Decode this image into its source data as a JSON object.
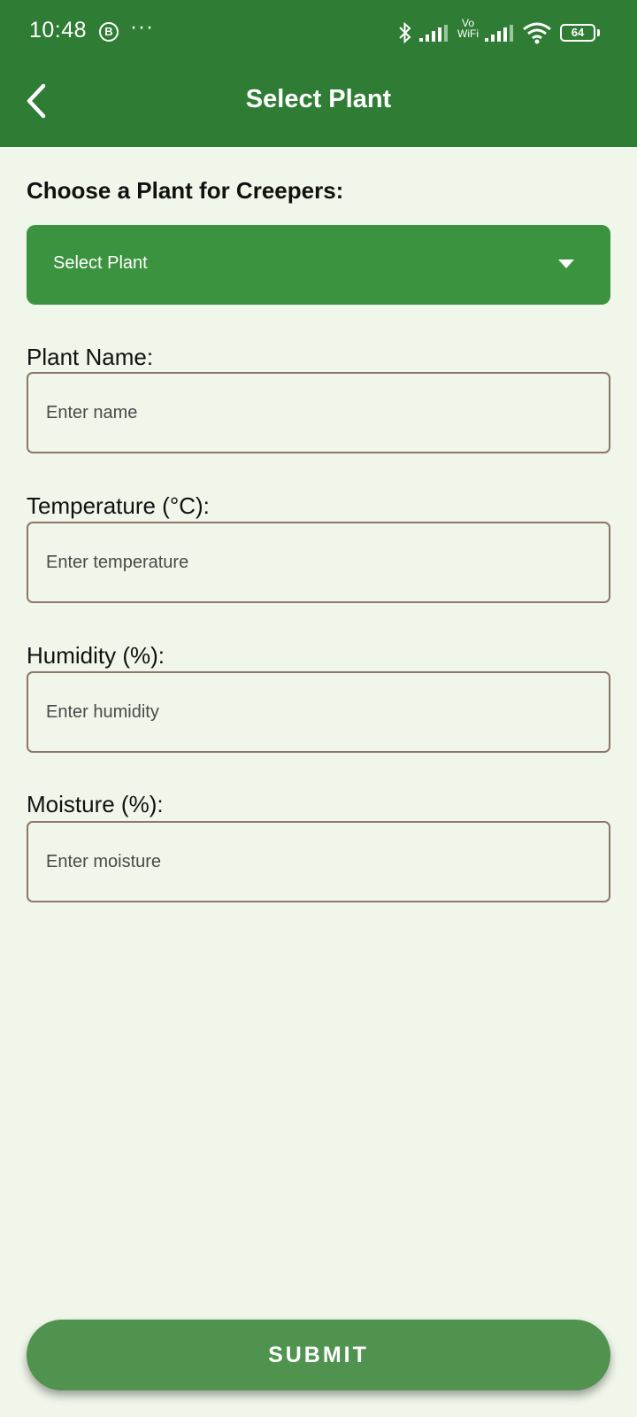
{
  "status_bar": {
    "time": "10:48",
    "notification_badge": "B",
    "more_indicator": "···",
    "vowifi_top": "Vo",
    "vowifi_bottom": "WiFi",
    "battery_level": "64",
    "icons": [
      "bluetooth-icon",
      "signal-icon",
      "vowifi-icon",
      "signal-icon",
      "wifi-icon",
      "battery-icon"
    ]
  },
  "header": {
    "title": "Select Plant",
    "back_icon": "chevron-left-icon"
  },
  "form": {
    "section_label": "Choose a Plant for Creepers:",
    "plant_select": {
      "value": "Select Plant",
      "icon": "caret-down-icon"
    },
    "fields": [
      {
        "label": "Plant Name:",
        "placeholder": "Enter name"
      },
      {
        "label": "Temperature (°C):",
        "placeholder": "Enter temperature"
      },
      {
        "label": "Humidity (%):",
        "placeholder": "Enter humidity"
      },
      {
        "label": "Moisture (%):",
        "placeholder": "Enter moisture"
      }
    ],
    "submit_label": "SUBMIT"
  },
  "colors": {
    "header_bg": "#2f7d34",
    "select_bg": "#3b923f",
    "submit_bg": "#4f934f",
    "page_bg": "#f1f6ea",
    "input_border": "#8d7668"
  }
}
